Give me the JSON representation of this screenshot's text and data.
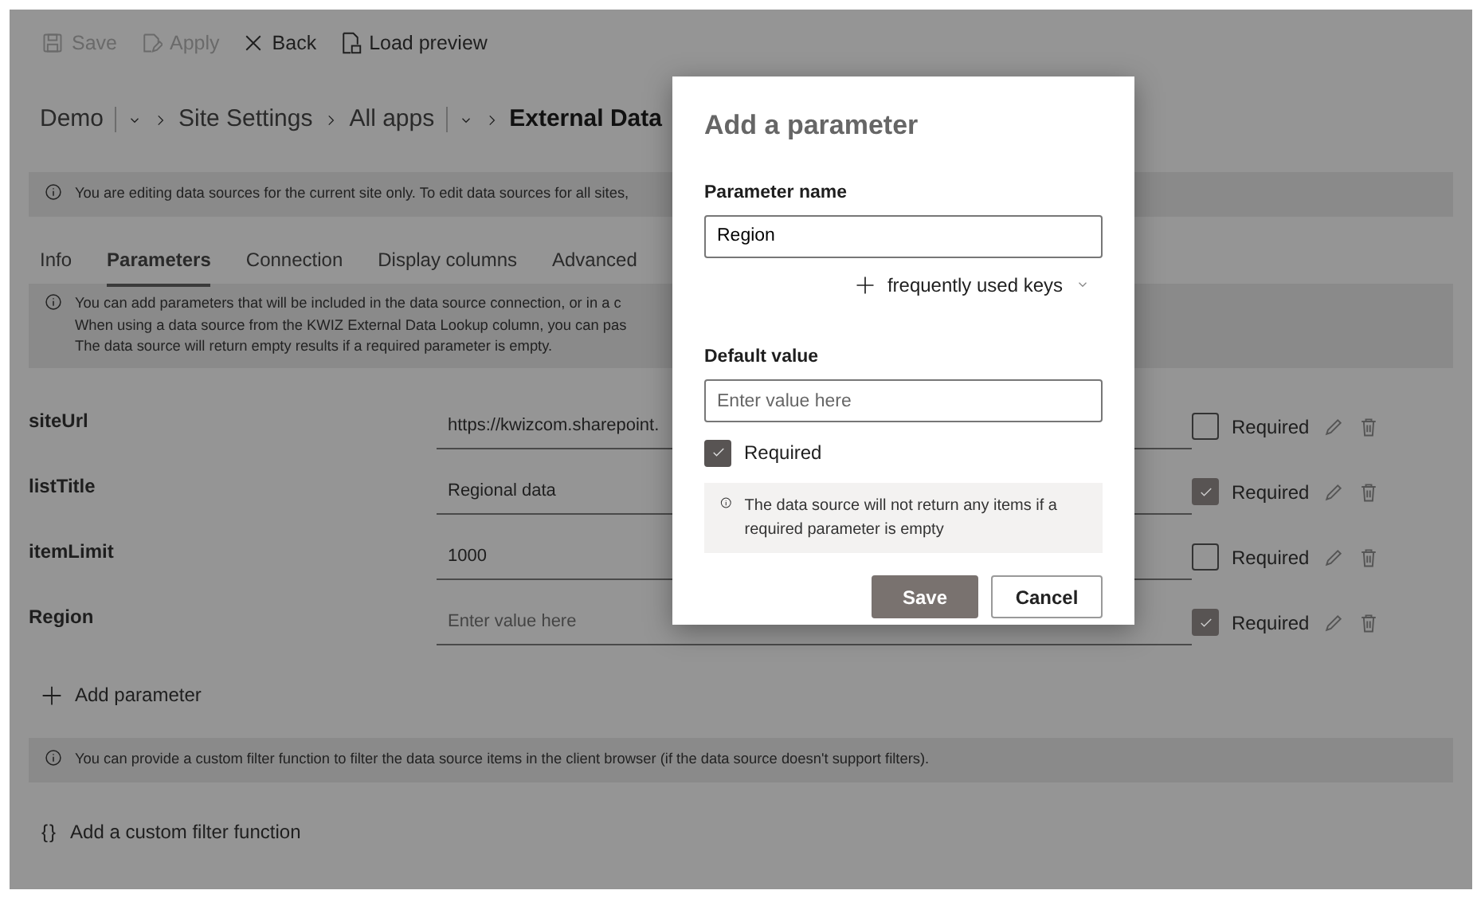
{
  "toolbar": [
    {
      "label": "Save",
      "kind": "save",
      "disabled": true
    },
    {
      "label": "Apply",
      "kind": "apply",
      "disabled": true
    },
    {
      "label": "Back",
      "kind": "back",
      "disabled": false
    },
    {
      "label": "Load preview",
      "kind": "preview",
      "disabled": false
    }
  ],
  "breadcrumb": [
    {
      "label": "Demo",
      "dropdown": true,
      "current": false
    },
    {
      "label": "Site Settings",
      "dropdown": false,
      "current": false
    },
    {
      "label": "All apps",
      "dropdown": true,
      "current": false
    },
    {
      "label": "External Data",
      "dropdown": false,
      "current": true
    }
  ],
  "notice": "You are editing data sources for the current site only. To edit data sources for all sites,",
  "tabs": [
    {
      "label": "Info",
      "selected": false
    },
    {
      "label": "Parameters",
      "selected": true
    },
    {
      "label": "Connection",
      "selected": false
    },
    {
      "label": "Display columns",
      "selected": false
    },
    {
      "label": "Advanced",
      "selected": false
    }
  ],
  "parameters_info": [
    "You can add parameters that will be included in the data source connection, or in a c",
    "When using a data source from the KWIZ External Data Lookup column, you can pas",
    "The data source will return empty results if a required parameter is empty."
  ],
  "parameters": [
    {
      "name": "siteUrl",
      "value": "https://kwizcom.sharepoint.",
      "required": false,
      "required_label": "Required"
    },
    {
      "name": "listTitle",
      "value": "Regional data",
      "required": true,
      "required_label": "Required"
    },
    {
      "name": "itemLimit",
      "value": "1000",
      "required": false,
      "required_label": "Required"
    },
    {
      "name": "Region",
      "placeholder": "Enter value here",
      "required": true,
      "required_label": "Required"
    }
  ],
  "add_parameter": "Add parameter",
  "filter_notice": "You can provide a custom filter function to filter the data source items in the client browser (if the data source doesn't support filters).",
  "add_filter": {
    "icon": "{}",
    "label": "Add a custom filter function"
  },
  "dialog": {
    "title": "Add a parameter",
    "name_label": "Parameter name",
    "name_value": "Region",
    "keys_link": "frequently used keys",
    "default_label": "Default value",
    "default_placeholder": "Enter value here",
    "required": true,
    "required_label": "Required",
    "note": "The data source will not return any items if a required parameter is empty",
    "buttons": [
      {
        "label": "Save",
        "kind": "primary"
      },
      {
        "label": "Cancel",
        "kind": "secondary"
      }
    ]
  }
}
